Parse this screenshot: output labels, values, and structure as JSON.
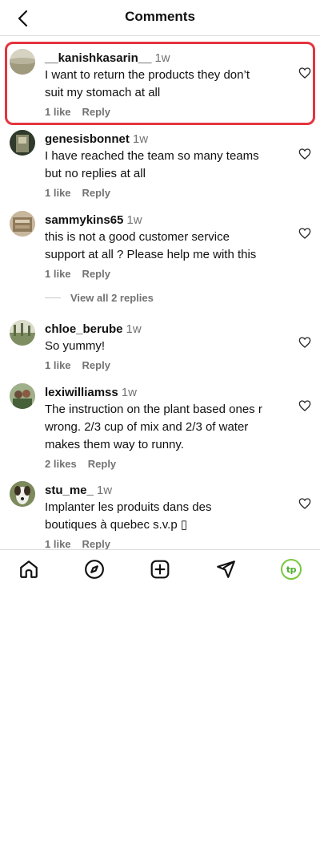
{
  "header": {
    "title": "Comments"
  },
  "comments": [
    {
      "username": "__kanishkasarin__",
      "time": "1w",
      "text_lines": [
        "I want to return the products they don’t",
        "suit my stomach at all"
      ],
      "likes": "1 like",
      "reply": "Reply",
      "avatar_color": "#b9b39a"
    },
    {
      "username": "genesisbonnet",
      "time": "1w",
      "text_lines": [
        "I have reached the team so many teams",
        "but no replies at all"
      ],
      "likes": "1 like",
      "reply": "Reply",
      "avatar_color": "#3e4a36"
    },
    {
      "username": "sammykins65",
      "time": "1w",
      "text_lines": [
        "this is not a good customer service",
        "support at all ? Please help me with this"
      ],
      "likes": "1 like",
      "reply": "Reply",
      "avatar_color": "#a89478"
    },
    {
      "username": "chloe_berube",
      "time": "1w",
      "text_lines": [
        "So yummy!"
      ],
      "likes": "1 like",
      "reply": "Reply",
      "avatar_color": "#8f9a76"
    },
    {
      "username": "lexiwilliamss",
      "time": "1w",
      "text_lines": [
        "The instruction on the plant based ones r",
        "wrong. 2/3 cup of mix and 2/3 of water",
        "makes them way to runny."
      ],
      "likes": "2 likes",
      "reply": "Reply",
      "avatar_color": "#5a6e4a"
    },
    {
      "username": "stu_me_",
      "time": "1w",
      "text_lines": [
        "Implanter les produits dans des",
        "boutiques à quebec s.v.p ▯"
      ],
      "likes": "1 like",
      "reply": "Reply",
      "avatar_color": "#6f7d55"
    }
  ],
  "view_replies": "View all 2 replies",
  "nav": {
    "items": [
      "home-icon",
      "explore-icon",
      "create-icon",
      "direct-icon",
      "profile-avatar"
    ],
    "profile_initials": "tp",
    "accent_color": "#78c83c"
  },
  "highlight_color": "#e4343f"
}
